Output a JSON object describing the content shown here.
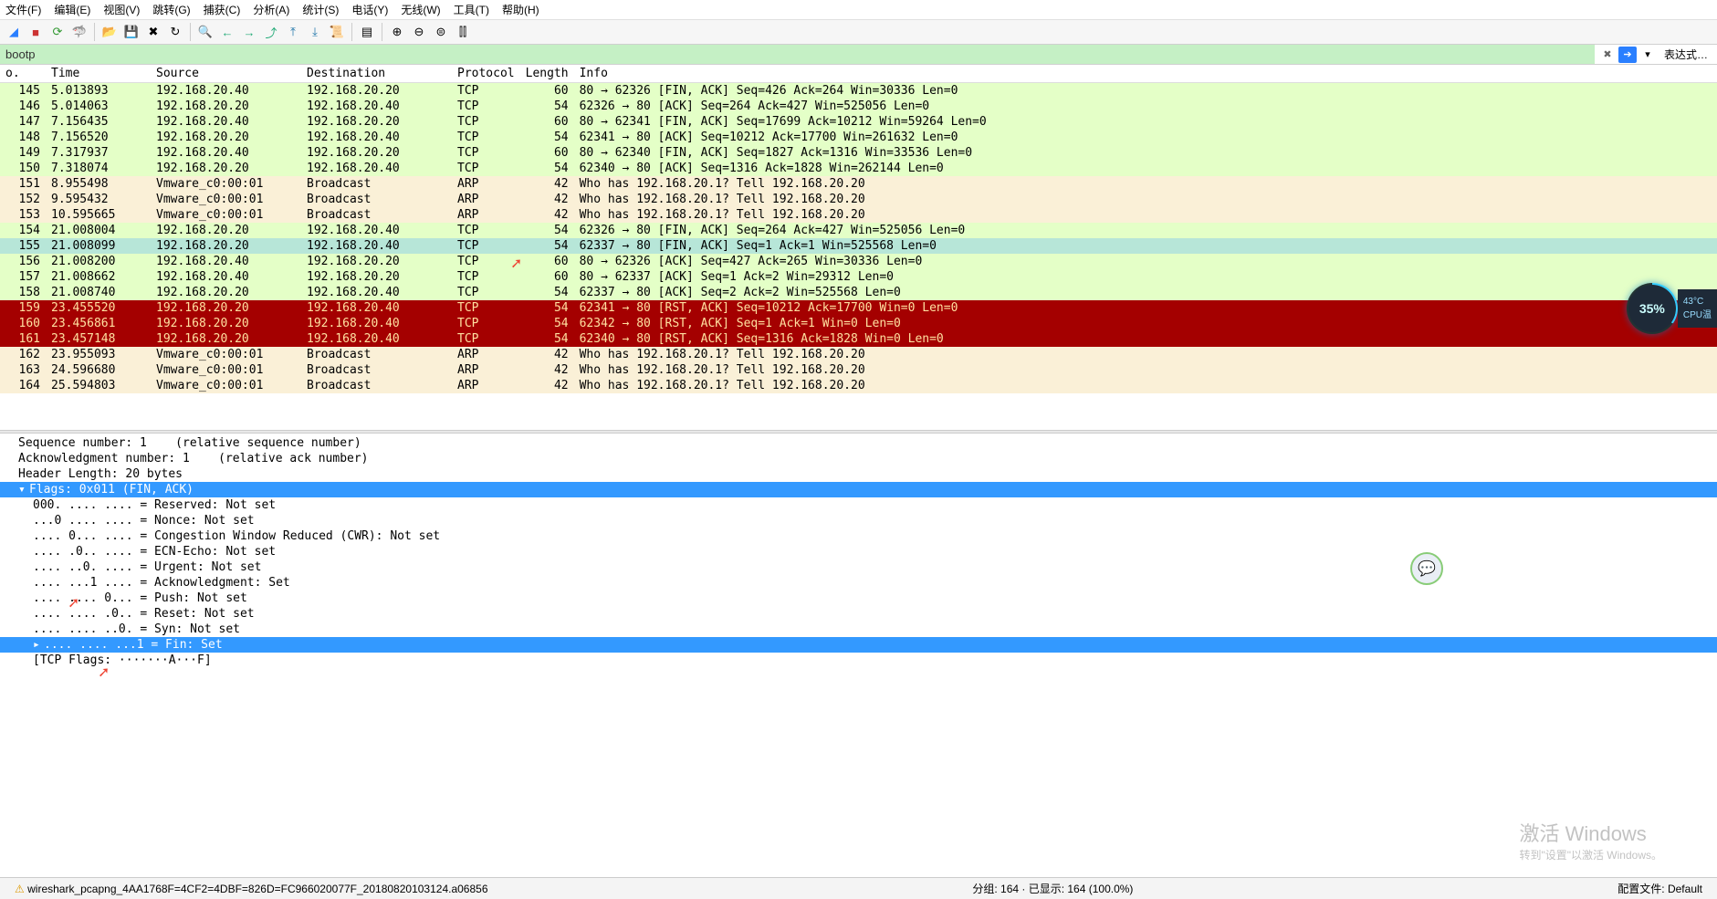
{
  "menu": {
    "file": "文件(F)",
    "edit": "编辑(E)",
    "view": "视图(V)",
    "go": "跳转(G)",
    "capture": "捕获(C)",
    "analyze": "分析(A)",
    "stats": "统计(S)",
    "telephony": "电话(Y)",
    "wireless": "无线(W)",
    "tools": "工具(T)",
    "help": "帮助(H)"
  },
  "filter": {
    "value": "bootp",
    "clear_title": "清除",
    "apply_title": "应用",
    "expr_label": "表达式…"
  },
  "columns": {
    "no": "o.",
    "time": "Time",
    "src": "Source",
    "dst": "Destination",
    "protocol": "Protocol",
    "length": "Length",
    "info": "Info"
  },
  "packets": [
    {
      "no": "145",
      "time": "5.013893",
      "src": "192.168.20.40",
      "dst": "192.168.20.20",
      "proto": "TCP",
      "len": "60",
      "info": "80 → 62326 [FIN, ACK] Seq=426 Ack=264 Win=30336 Len=0",
      "cls": "row-tcp-green"
    },
    {
      "no": "146",
      "time": "5.014063",
      "src": "192.168.20.20",
      "dst": "192.168.20.40",
      "proto": "TCP",
      "len": "54",
      "info": "62326 → 80 [ACK] Seq=264 Ack=427 Win=525056 Len=0",
      "cls": "row-tcp-green"
    },
    {
      "no": "147",
      "time": "7.156435",
      "src": "192.168.20.40",
      "dst": "192.168.20.20",
      "proto": "TCP",
      "len": "60",
      "info": "80 → 62341 [FIN, ACK] Seq=17699 Ack=10212 Win=59264 Len=0",
      "cls": "row-tcp-green"
    },
    {
      "no": "148",
      "time": "7.156520",
      "src": "192.168.20.20",
      "dst": "192.168.20.40",
      "proto": "TCP",
      "len": "54",
      "info": "62341 → 80 [ACK] Seq=10212 Ack=17700 Win=261632 Len=0",
      "cls": "row-tcp-green"
    },
    {
      "no": "149",
      "time": "7.317937",
      "src": "192.168.20.40",
      "dst": "192.168.20.20",
      "proto": "TCP",
      "len": "60",
      "info": "80 → 62340 [FIN, ACK] Seq=1827 Ack=1316 Win=33536 Len=0",
      "cls": "row-tcp-green"
    },
    {
      "no": "150",
      "time": "7.318074",
      "src": "192.168.20.20",
      "dst": "192.168.20.40",
      "proto": "TCP",
      "len": "54",
      "info": "62340 → 80 [ACK] Seq=1316 Ack=1828 Win=262144 Len=0",
      "cls": "row-tcp-green"
    },
    {
      "no": "151",
      "time": "8.955498",
      "src": "Vmware_c0:00:01",
      "dst": "Broadcast",
      "proto": "ARP",
      "len": "42",
      "info": "Who has 192.168.20.1? Tell 192.168.20.20",
      "cls": "row-arp"
    },
    {
      "no": "152",
      "time": "9.595432",
      "src": "Vmware_c0:00:01",
      "dst": "Broadcast",
      "proto": "ARP",
      "len": "42",
      "info": "Who has 192.168.20.1? Tell 192.168.20.20",
      "cls": "row-arp"
    },
    {
      "no": "153",
      "time": "10.595665",
      "src": "Vmware_c0:00:01",
      "dst": "Broadcast",
      "proto": "ARP",
      "len": "42",
      "info": "Who has 192.168.20.1? Tell 192.168.20.20",
      "cls": "row-arp"
    },
    {
      "no": "154",
      "time": "21.008004",
      "src": "192.168.20.20",
      "dst": "192.168.20.40",
      "proto": "TCP",
      "len": "54",
      "info": "62326 → 80 [FIN, ACK] Seq=264 Ack=427 Win=525056 Len=0",
      "cls": "row-tcp-green"
    },
    {
      "no": "155",
      "time": "21.008099",
      "src": "192.168.20.20",
      "dst": "192.168.20.40",
      "proto": "TCP",
      "len": "54",
      "info": "62337 → 80 [FIN, ACK] Seq=1 Ack=1 Win=525568 Len=0",
      "cls": "row-sel"
    },
    {
      "no": "156",
      "time": "21.008200",
      "src": "192.168.20.40",
      "dst": "192.168.20.20",
      "proto": "TCP",
      "len": "60",
      "info": "80 → 62326 [ACK] Seq=427 Ack=265 Win=30336 Len=0",
      "cls": "row-tcp-green"
    },
    {
      "no": "157",
      "time": "21.008662",
      "src": "192.168.20.40",
      "dst": "192.168.20.20",
      "proto": "TCP",
      "len": "60",
      "info": "80 → 62337 [ACK] Seq=1 Ack=2 Win=29312 Len=0",
      "cls": "row-tcp-green"
    },
    {
      "no": "158",
      "time": "21.008740",
      "src": "192.168.20.20",
      "dst": "192.168.20.40",
      "proto": "TCP",
      "len": "54",
      "info": "62337 → 80 [ACK] Seq=2 Ack=2 Win=525568 Len=0",
      "cls": "row-tcp-green"
    },
    {
      "no": "159",
      "time": "23.455520",
      "src": "192.168.20.20",
      "dst": "192.168.20.40",
      "proto": "TCP",
      "len": "54",
      "info": "62341 → 80 [RST, ACK] Seq=10212 Ack=17700 Win=0 Len=0",
      "cls": "row-rst"
    },
    {
      "no": "160",
      "time": "23.456861",
      "src": "192.168.20.20",
      "dst": "192.168.20.40",
      "proto": "TCP",
      "len": "54",
      "info": "62342 → 80 [RST, ACK] Seq=1 Ack=1 Win=0 Len=0",
      "cls": "row-rst"
    },
    {
      "no": "161",
      "time": "23.457148",
      "src": "192.168.20.20",
      "dst": "192.168.20.40",
      "proto": "TCP",
      "len": "54",
      "info": "62340 → 80 [RST, ACK] Seq=1316 Ack=1828 Win=0 Len=0",
      "cls": "row-rst"
    },
    {
      "no": "162",
      "time": "23.955093",
      "src": "Vmware_c0:00:01",
      "dst": "Broadcast",
      "proto": "ARP",
      "len": "42",
      "info": "Who has 192.168.20.1? Tell 192.168.20.20",
      "cls": "row-arp"
    },
    {
      "no": "163",
      "time": "24.596680",
      "src": "Vmware_c0:00:01",
      "dst": "Broadcast",
      "proto": "ARP",
      "len": "42",
      "info": "Who has 192.168.20.1? Tell 192.168.20.20",
      "cls": "row-arp"
    },
    {
      "no": "164",
      "time": "25.594803",
      "src": "Vmware_c0:00:01",
      "dst": "Broadcast",
      "proto": "ARP",
      "len": "42",
      "info": "Who has 192.168.20.1? Tell 192.168.20.20",
      "cls": "row-arp"
    }
  ],
  "details": {
    "seq": "Sequence number: 1    (relative sequence number)",
    "ack": "Acknowledgment number: 1    (relative ack number)",
    "hlen": "Header Length: 20 bytes",
    "flags": "Flags: 0x011 (FIN, ACK)",
    "reserved": "000. .... .... = Reserved: Not set",
    "nonce": "...0 .... .... = Nonce: Not set",
    "cwr": ".... 0... .... = Congestion Window Reduced (CWR): Not set",
    "ecn": ".... .0.. .... = ECN-Echo: Not set",
    "urgent": ".... ..0. .... = Urgent: Not set",
    "ackf": ".... ...1 .... = Acknowledgment: Set",
    "push": ".... .... 0... = Push: Not set",
    "reset": ".... .... .0.. = Reset: Not set",
    "syn": ".... .... ..0. = Syn: Not set",
    "fin": ".... .... ...1 = Fin: Set",
    "flagstr": "[TCP Flags: ·······A···F]"
  },
  "statusbar": {
    "left": "wireshark_pcapng_4AA1768F=4CF2=4DBF=826D=FC966020077F_20180820103124.a06856",
    "center": "分组: 164 · 已显示: 164 (100.0%)",
    "right": "配置文件: Default"
  },
  "watermark": {
    "title": "激活 Windows",
    "sub": "转到\"设置\"以激活 Windows。"
  },
  "cpu": {
    "percent": "35%",
    "temp": "43°C",
    "label": "CPU温"
  }
}
